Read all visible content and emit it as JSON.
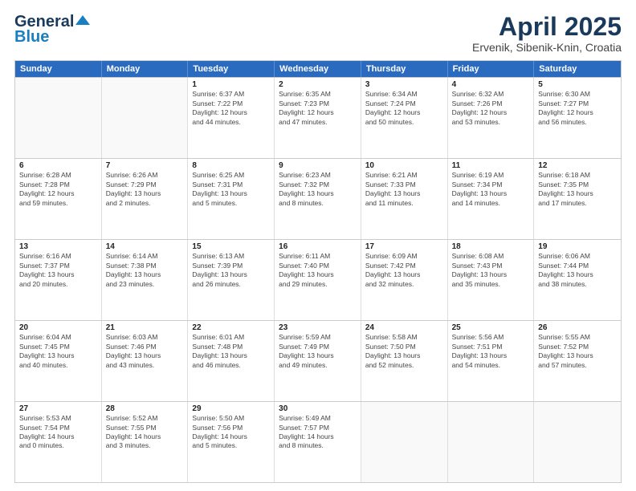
{
  "header": {
    "logo_line1": "General",
    "logo_line2": "Blue",
    "month": "April 2025",
    "location": "Ervenik, Sibenik-Knin, Croatia"
  },
  "days": [
    "Sunday",
    "Monday",
    "Tuesday",
    "Wednesday",
    "Thursday",
    "Friday",
    "Saturday"
  ],
  "rows": [
    [
      {
        "day": "",
        "info": ""
      },
      {
        "day": "",
        "info": ""
      },
      {
        "day": "1",
        "info": "Sunrise: 6:37 AM\nSunset: 7:22 PM\nDaylight: 12 hours\nand 44 minutes."
      },
      {
        "day": "2",
        "info": "Sunrise: 6:35 AM\nSunset: 7:23 PM\nDaylight: 12 hours\nand 47 minutes."
      },
      {
        "day": "3",
        "info": "Sunrise: 6:34 AM\nSunset: 7:24 PM\nDaylight: 12 hours\nand 50 minutes."
      },
      {
        "day": "4",
        "info": "Sunrise: 6:32 AM\nSunset: 7:26 PM\nDaylight: 12 hours\nand 53 minutes."
      },
      {
        "day": "5",
        "info": "Sunrise: 6:30 AM\nSunset: 7:27 PM\nDaylight: 12 hours\nand 56 minutes."
      }
    ],
    [
      {
        "day": "6",
        "info": "Sunrise: 6:28 AM\nSunset: 7:28 PM\nDaylight: 12 hours\nand 59 minutes."
      },
      {
        "day": "7",
        "info": "Sunrise: 6:26 AM\nSunset: 7:29 PM\nDaylight: 13 hours\nand 2 minutes."
      },
      {
        "day": "8",
        "info": "Sunrise: 6:25 AM\nSunset: 7:31 PM\nDaylight: 13 hours\nand 5 minutes."
      },
      {
        "day": "9",
        "info": "Sunrise: 6:23 AM\nSunset: 7:32 PM\nDaylight: 13 hours\nand 8 minutes."
      },
      {
        "day": "10",
        "info": "Sunrise: 6:21 AM\nSunset: 7:33 PM\nDaylight: 13 hours\nand 11 minutes."
      },
      {
        "day": "11",
        "info": "Sunrise: 6:19 AM\nSunset: 7:34 PM\nDaylight: 13 hours\nand 14 minutes."
      },
      {
        "day": "12",
        "info": "Sunrise: 6:18 AM\nSunset: 7:35 PM\nDaylight: 13 hours\nand 17 minutes."
      }
    ],
    [
      {
        "day": "13",
        "info": "Sunrise: 6:16 AM\nSunset: 7:37 PM\nDaylight: 13 hours\nand 20 minutes."
      },
      {
        "day": "14",
        "info": "Sunrise: 6:14 AM\nSunset: 7:38 PM\nDaylight: 13 hours\nand 23 minutes."
      },
      {
        "day": "15",
        "info": "Sunrise: 6:13 AM\nSunset: 7:39 PM\nDaylight: 13 hours\nand 26 minutes."
      },
      {
        "day": "16",
        "info": "Sunrise: 6:11 AM\nSunset: 7:40 PM\nDaylight: 13 hours\nand 29 minutes."
      },
      {
        "day": "17",
        "info": "Sunrise: 6:09 AM\nSunset: 7:42 PM\nDaylight: 13 hours\nand 32 minutes."
      },
      {
        "day": "18",
        "info": "Sunrise: 6:08 AM\nSunset: 7:43 PM\nDaylight: 13 hours\nand 35 minutes."
      },
      {
        "day": "19",
        "info": "Sunrise: 6:06 AM\nSunset: 7:44 PM\nDaylight: 13 hours\nand 38 minutes."
      }
    ],
    [
      {
        "day": "20",
        "info": "Sunrise: 6:04 AM\nSunset: 7:45 PM\nDaylight: 13 hours\nand 40 minutes."
      },
      {
        "day": "21",
        "info": "Sunrise: 6:03 AM\nSunset: 7:46 PM\nDaylight: 13 hours\nand 43 minutes."
      },
      {
        "day": "22",
        "info": "Sunrise: 6:01 AM\nSunset: 7:48 PM\nDaylight: 13 hours\nand 46 minutes."
      },
      {
        "day": "23",
        "info": "Sunrise: 5:59 AM\nSunset: 7:49 PM\nDaylight: 13 hours\nand 49 minutes."
      },
      {
        "day": "24",
        "info": "Sunrise: 5:58 AM\nSunset: 7:50 PM\nDaylight: 13 hours\nand 52 minutes."
      },
      {
        "day": "25",
        "info": "Sunrise: 5:56 AM\nSunset: 7:51 PM\nDaylight: 13 hours\nand 54 minutes."
      },
      {
        "day": "26",
        "info": "Sunrise: 5:55 AM\nSunset: 7:52 PM\nDaylight: 13 hours\nand 57 minutes."
      }
    ],
    [
      {
        "day": "27",
        "info": "Sunrise: 5:53 AM\nSunset: 7:54 PM\nDaylight: 14 hours\nand 0 minutes."
      },
      {
        "day": "28",
        "info": "Sunrise: 5:52 AM\nSunset: 7:55 PM\nDaylight: 14 hours\nand 3 minutes."
      },
      {
        "day": "29",
        "info": "Sunrise: 5:50 AM\nSunset: 7:56 PM\nDaylight: 14 hours\nand 5 minutes."
      },
      {
        "day": "30",
        "info": "Sunrise: 5:49 AM\nSunset: 7:57 PM\nDaylight: 14 hours\nand 8 minutes."
      },
      {
        "day": "",
        "info": ""
      },
      {
        "day": "",
        "info": ""
      },
      {
        "day": "",
        "info": ""
      }
    ]
  ]
}
